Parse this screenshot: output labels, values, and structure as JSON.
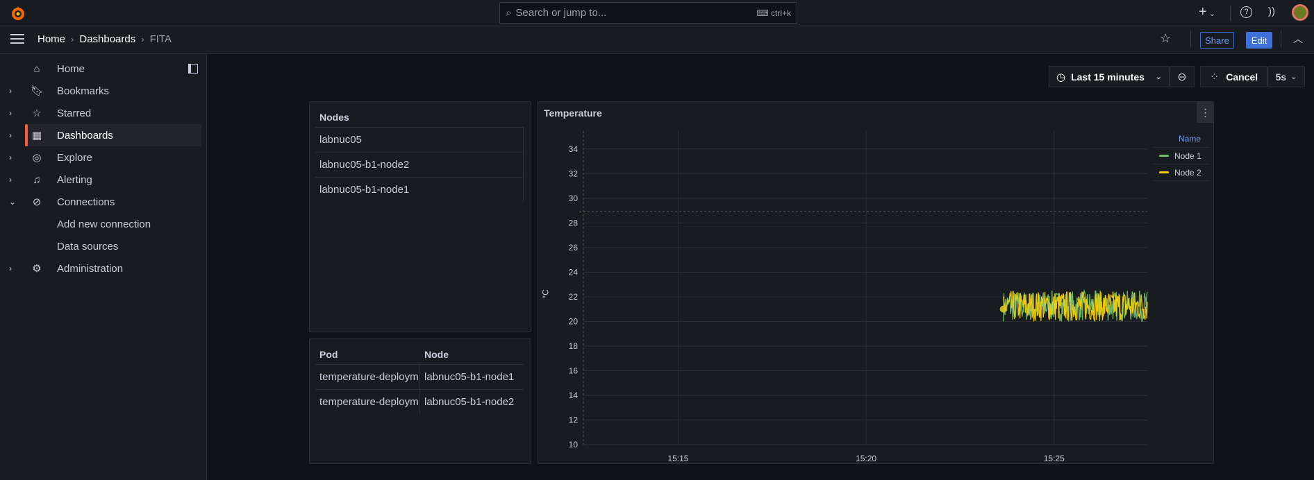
{
  "topbar": {
    "search_placeholder": "Search or jump to...",
    "search_shortcut": "ctrl+k",
    "new_label": "+"
  },
  "breadcrumb": [
    "Home",
    "Dashboards",
    "FITA"
  ],
  "actions": {
    "share": "Share",
    "edit": "Edit"
  },
  "sidebar": {
    "items": [
      {
        "label": "Home",
        "icon": "home-icon",
        "chevron": ""
      },
      {
        "label": "Bookmarks",
        "icon": "bookmark-icon",
        "chevron": "›"
      },
      {
        "label": "Starred",
        "icon": "star-icon",
        "chevron": "›"
      },
      {
        "label": "Dashboards",
        "icon": "grid-icon",
        "chevron": "›"
      },
      {
        "label": "Explore",
        "icon": "compass-icon",
        "chevron": "›"
      },
      {
        "label": "Alerting",
        "icon": "bell-icon",
        "chevron": "›"
      },
      {
        "label": "Connections",
        "icon": "link-icon",
        "chevron": "⌄"
      },
      {
        "label": "Add new connection",
        "icon": "",
        "chevron": ""
      },
      {
        "label": "Data sources",
        "icon": "",
        "chevron": ""
      },
      {
        "label": "Administration",
        "icon": "gear-icon",
        "chevron": "›"
      }
    ]
  },
  "toolbar": {
    "time_range": "Last 15 minutes",
    "cancel": "Cancel",
    "refresh": "5s"
  },
  "nodes_panel": {
    "header": "Nodes",
    "rows": [
      "labnuc05",
      "labnuc05-b1-node2",
      "labnuc05-b1-node1"
    ]
  },
  "pods_panel": {
    "headers": [
      "Pod",
      "Node"
    ],
    "rows": [
      [
        "temperature-deploym",
        "labnuc05-b1-node1"
      ],
      [
        "temperature-deploym",
        "labnuc05-b1-node2"
      ]
    ]
  },
  "chart_data": {
    "type": "line",
    "title": "Temperature",
    "ylabel": "°C",
    "ylim": [
      10,
      35
    ],
    "yticks": [
      "10",
      "12",
      "14",
      "16",
      "18",
      "20",
      "22",
      "24",
      "26",
      "28",
      "30",
      "32",
      "34"
    ],
    "xticks": [
      "15:15",
      "15:20",
      "15:25"
    ],
    "x_range_minutes": [
      -2.52,
      12.48
    ],
    "threshold_dashed": 28.9,
    "legend_header": "Name",
    "series": [
      {
        "name": "Node 1",
        "color": "#73bf69",
        "start_min": 8.65,
        "end_min": 12.48,
        "min": 20.0,
        "max": 22.5
      },
      {
        "name": "Node 2",
        "color": "#f2cc0c",
        "start_min": 8.65,
        "end_min": 12.48,
        "min": 20.0,
        "max": 22.5
      }
    ]
  },
  "colors": {
    "accent": "#3d71d9",
    "brand": "#f55f3e"
  }
}
